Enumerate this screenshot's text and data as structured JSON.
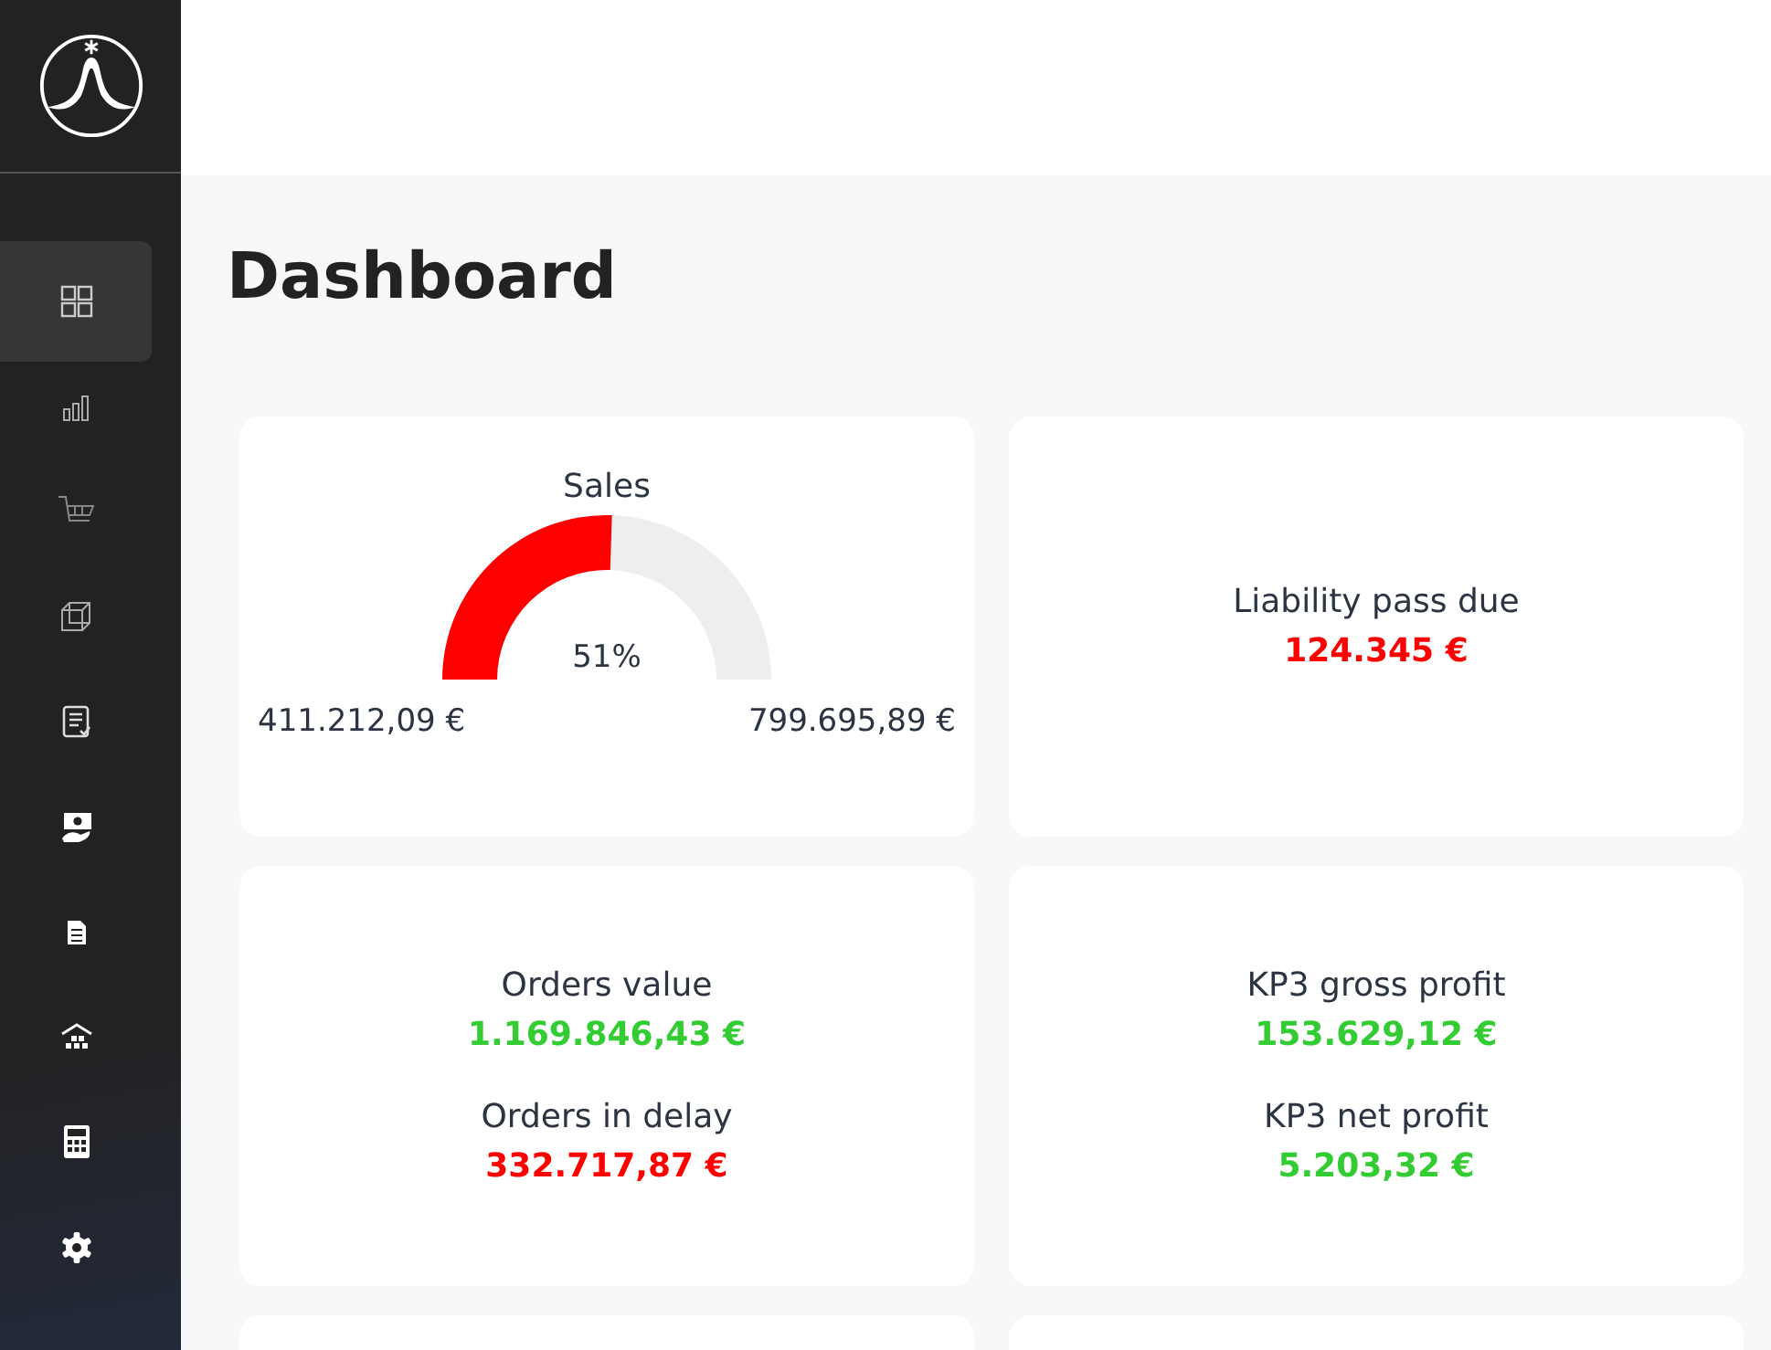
{
  "sidebar": {
    "items": [
      {
        "kind": "grid",
        "selected": true
      },
      {
        "kind": "chart",
        "selected": false
      },
      {
        "kind": "cart",
        "selected": false
      },
      {
        "kind": "box",
        "selected": false
      },
      {
        "kind": "checklist",
        "selected": false
      },
      {
        "kind": "money",
        "selected": false
      },
      {
        "kind": "document",
        "selected": false
      },
      {
        "kind": "warehouse",
        "selected": false
      },
      {
        "kind": "calculator",
        "selected": false
      },
      {
        "kind": "settings",
        "selected": false
      }
    ]
  },
  "page_title": "Dashboard",
  "sales": {
    "title": "Sales",
    "level": 0.51,
    "percent": "51%",
    "min": "411.212,09 €",
    "max": "799.695,89 €"
  },
  "cards": [
    {
      "metrics": [
        {
          "label": "Liability pass due",
          "value": "124.345 €",
          "color": "#ff0000"
        }
      ]
    },
    {
      "metrics": [
        {
          "label": "Orders value",
          "value": "1.169.846,43 €",
          "color": "#33cc33"
        },
        {
          "label": "Orders in delay",
          "value": "332.717,87 €",
          "color": "#ff0000"
        }
      ]
    },
    {
      "metrics": [
        {
          "label": "KP3 gross profit",
          "value": "153.629,12 €",
          "color": "#33cc33"
        },
        {
          "label": "KP3 net profit",
          "value": "5.203,32 €",
          "color": "#33cc33"
        }
      ]
    },
    {
      "kind": "empty"
    },
    {
      "kind": "empty"
    }
  ]
}
